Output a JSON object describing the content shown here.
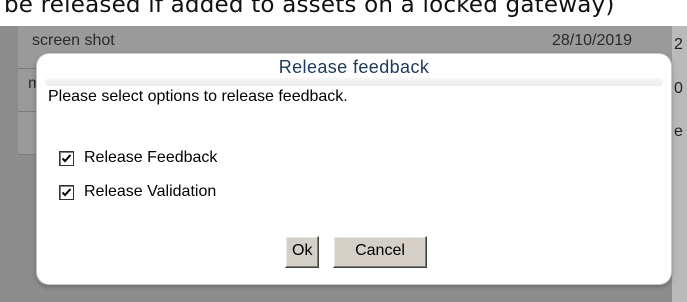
{
  "background": {
    "top_text": "be released if added to assets on a locked gateway)",
    "rows": [
      {
        "name": "screen shot",
        "date": "28/10/2019",
        "tail": "2"
      },
      {
        "name": "m",
        "date": "",
        "tail": "0"
      },
      {
        "name": "",
        "date": "",
        "tail": "e"
      }
    ]
  },
  "dialog": {
    "title": "Release feedback",
    "message": "Please select options to release feedback.",
    "options": [
      {
        "label": "Release Feedback",
        "checked": true
      },
      {
        "label": "Release Validation",
        "checked": true
      }
    ],
    "ok_label": "Ok",
    "cancel_label": "Cancel"
  },
  "colors": {
    "title": "#203a5a",
    "overlay": "#8d8d8d",
    "button_face": "#d4d0c8"
  }
}
